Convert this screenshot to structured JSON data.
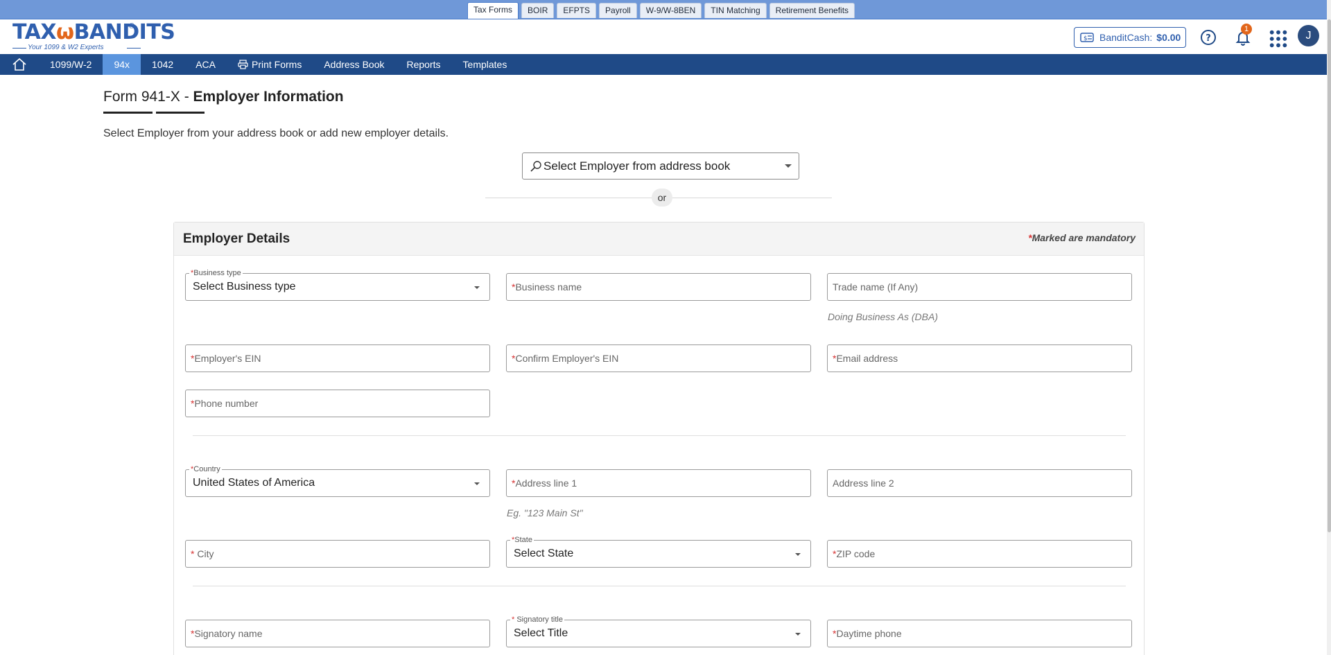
{
  "product_tabs": [
    "Tax Forms",
    "BOIR",
    "EFPTS",
    "Payroll",
    "W-9/W-8BEN",
    "TIN Matching",
    "Retirement Benefits"
  ],
  "logo": {
    "text_a": "TAX",
    "text_b": "BANDITS",
    "reg": "®",
    "tagline": "Your 1099 & W2 Experts"
  },
  "header": {
    "cash_label": "BanditCash:",
    "cash_amount": "$0.00",
    "notification_count": "1",
    "avatar_initial": "J"
  },
  "nav": {
    "items": [
      {
        "label": "1099/W-2"
      },
      {
        "label": "94x",
        "active": true
      },
      {
        "label": "1042"
      },
      {
        "label": "ACA"
      },
      {
        "label": "Print Forms",
        "icon": "printer-icon"
      },
      {
        "label": "Address Book"
      },
      {
        "label": "Reports"
      },
      {
        "label": "Templates"
      }
    ]
  },
  "page": {
    "title_prefix": "Form 941-X - ",
    "title_strong": "Employer Information",
    "subtitle": "Select Employer from your address book or add new employer details.",
    "employer_select": "Select Employer from address book",
    "or": "or"
  },
  "card": {
    "title": "Employer Details",
    "mandatory_note": "Marked are mandatory",
    "business_type": {
      "label": "Business type",
      "value": "Select Business type"
    },
    "business_name": "Business name",
    "trade_name": "Trade name (If Any)",
    "trade_hint": "Doing Business As (DBA)",
    "ein": "Employer's EIN",
    "confirm_ein": "Confirm Employer's EIN",
    "email": "Email address",
    "phone": "Phone number",
    "country": {
      "label": "Country",
      "value": "United States of America"
    },
    "address1": "Address line 1",
    "address1_hint": "Eg. \"123 Main St\"",
    "address2": "Address line 2",
    "city": " City",
    "state": {
      "label": "State",
      "value": "Select State"
    },
    "zip": "ZIP code",
    "signatory_name": "Signatory name",
    "signatory_title": {
      "label": " Signatory title",
      "value": "Select Title"
    },
    "daytime_phone": "Daytime phone"
  },
  "colors": {
    "nav_bg": "#1f4a87",
    "nav_active": "#5b95de",
    "topbar": "#6f98d8",
    "accent": "#2f5fae",
    "required": "#d63232"
  }
}
